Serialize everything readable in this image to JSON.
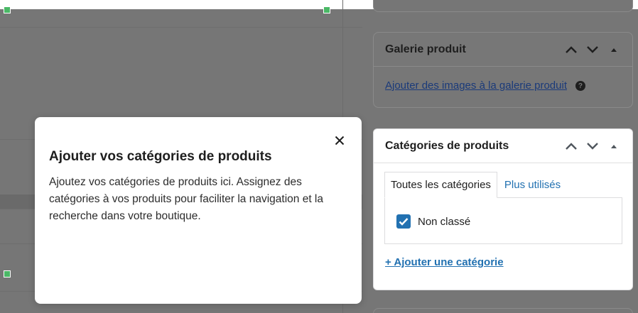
{
  "popover": {
    "title": "Ajouter vos catégories de produits",
    "body": "Ajoutez vos catégories de produits ici. Assignez des catégories à vos produits pour faciliter la navigation et la recherche dans votre boutique.",
    "close_icon": "close-icon"
  },
  "gallery_box": {
    "title": "Galerie produit",
    "link": "Ajouter des images à la galerie produit",
    "help_icon": "?"
  },
  "categories_box": {
    "title": "Catégories de produits",
    "tabs": [
      {
        "label": "Toutes les catégories"
      },
      {
        "label": "Plus utilisés"
      }
    ],
    "items": [
      {
        "label": "Non classé",
        "checked": true
      }
    ],
    "add_link": "+ Ajouter une catégorie"
  },
  "colors": {
    "accent": "#2271b1",
    "handle": "#4ab866",
    "overlay": "#757575"
  }
}
